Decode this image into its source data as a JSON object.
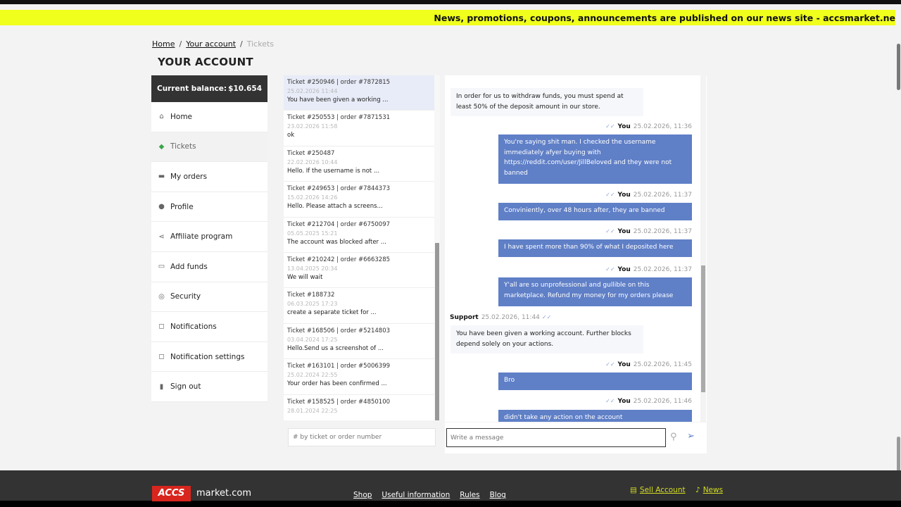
{
  "ticker": {
    "text": "News, promotions, coupons, announcements are published on our news site - accsmarket.ne"
  },
  "breadcrumb": {
    "home": "Home",
    "account": "Your account",
    "current": "Tickets",
    "sep": "/"
  },
  "page_title": "YOUR ACCOUNT",
  "balance": {
    "label": "Current balance:",
    "value": "$10.654"
  },
  "menu": [
    {
      "label": "Home",
      "icon": "home-icon",
      "glyph": "⌂"
    },
    {
      "label": "Tickets",
      "icon": "ticket-icon",
      "glyph": "◆"
    },
    {
      "label": "My orders",
      "icon": "cart-icon",
      "glyph": "▬"
    },
    {
      "label": "Profile",
      "icon": "user-icon",
      "glyph": "●"
    },
    {
      "label": "Affiliate program",
      "icon": "share-icon",
      "glyph": "⋖"
    },
    {
      "label": "Add funds",
      "icon": "wallet-icon",
      "glyph": "▭"
    },
    {
      "label": "Security",
      "icon": "shield-icon",
      "glyph": "◎"
    },
    {
      "label": "Notifications",
      "icon": "bell-icon",
      "glyph": "◻"
    },
    {
      "label": "Notification settings",
      "icon": "bell-settings-icon",
      "glyph": "◻"
    },
    {
      "label": "Sign out",
      "icon": "sign-out-icon",
      "glyph": "▮"
    }
  ],
  "tickets": [
    {
      "head": "Ticket #250946 | order #7872815",
      "date": "25.02.2026 11:44",
      "msg": "You have been given a working ..."
    },
    {
      "head": "Ticket #250553 | order #7871531",
      "date": "23.02.2026 11:58",
      "msg": "ok"
    },
    {
      "head": "Ticket #250487",
      "date": "22.02.2026 10:44",
      "msg": "Hello. If the username is not ..."
    },
    {
      "head": "Ticket #249653 | order #7844373",
      "date": "15.02.2026 14:26",
      "msg": "Hello. Please attach a screens..."
    },
    {
      "head": "Ticket #212704 | order #6750097",
      "date": "05.05.2025 15:21",
      "msg": "The account was blocked after ..."
    },
    {
      "head": "Ticket #210242 | order #6663285",
      "date": "13.04.2025 20:34",
      "msg": "We will wait"
    },
    {
      "head": "Ticket #188732",
      "date": "06.03.2025 17:23",
      "msg": "create a separate ticket for ..."
    },
    {
      "head": "Ticket #168506 | order #5214803",
      "date": "03.04.2024 17:25",
      "msg": "Hello.Send us a screenshot of ..."
    },
    {
      "head": "Ticket #163101 | order #5006399",
      "date": "25.02.2024 22:55",
      "msg": "Your order has been confirmed ..."
    },
    {
      "head": "Ticket #158525 | order #4850100",
      "date": "28.01.2024 22:25",
      "msg": ""
    }
  ],
  "chat": {
    "msg0": "In order for us to withdraw funds, you must spend at least 50% of the deposit amount in our store.",
    "you_label": "You",
    "support_label": "Support",
    "check": "✓✓",
    "m1_time": "25.02.2026, 11:36",
    "m1_text": "You're saying shit man. I checked the username immediately afyer buying with https://reddit.com/user/JillBeloved and they were not banned",
    "m2_time": "25.02.2026, 11:37",
    "m2_text": "Conviniently, over 48 hours after, they are banned",
    "m3_time": "25.02.2026, 11:37",
    "m3_text": "I have spent more than 90% of what I deposited here",
    "m4_time": "25.02.2026, 11:37",
    "m4_text": "Y'all are so unprofessional and gullible on this marketplace. Refund my money for my orders please",
    "s1_time": "25.02.2026, 11:44",
    "s1_text": "You have been given a working account. Further blocks depend solely on your actions.",
    "m5_time": "25.02.2026, 11:45",
    "m5_text": "Bro",
    "m6_time": "25.02.2026, 11:46",
    "m6_text": "didn't take any action on the account"
  },
  "search": {
    "placeholder": "# by ticket or order number"
  },
  "compose": {
    "placeholder": "Write a message",
    "attach_glyph": "⚲",
    "send_glyph": "➢"
  },
  "footer": {
    "logo": "ACCS",
    "logo_text": "market.com",
    "links": [
      "Shop",
      "Useful information",
      "Rules",
      "Blog"
    ],
    "sell": "Sell Account",
    "sell_glyph": "▤",
    "news": "News",
    "news_glyph": "♪"
  },
  "colors": {
    "ticker": "#f0ff1c",
    "accent": "#5f7fc7",
    "footer": "#333333",
    "logo": "#d8261e"
  }
}
